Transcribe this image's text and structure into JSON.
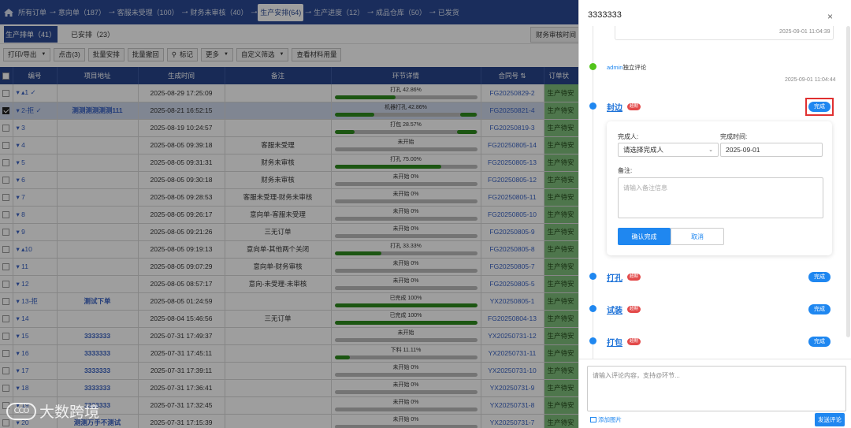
{
  "nav": {
    "items": [
      "所有订单",
      "意向单（187）",
      "客服未受理（100）",
      "财务未审核（40）",
      "生产安排(64)",
      "生产进度（12）",
      "成品仓库（50）",
      "已发货"
    ],
    "separator": "---•",
    "active_index": 4
  },
  "tabs": {
    "primary": "生产排单（41）",
    "secondary": "已安排（23）",
    "right": "财务审核时间"
  },
  "toolbar": {
    "buttons": [
      {
        "label": "打印/导出",
        "caret": "▼"
      },
      {
        "label": "点击(3)",
        "caret": ""
      },
      {
        "label": "批量安排",
        "caret": ""
      },
      {
        "label": "批量撤回",
        "caret": ""
      },
      {
        "label": "标记",
        "caret": ""
      },
      {
        "label": "更多",
        "caret": "▼"
      },
      {
        "label": "自定义筛选",
        "caret": "▼"
      },
      {
        "label": "查看材料用量",
        "caret": ""
      }
    ]
  },
  "table": {
    "headers": [
      "编号",
      "项目地址",
      "生成时间",
      "备注",
      "环节详情",
      "合同号 ⇅",
      "订单状"
    ],
    "rows": [
      {
        "check": false,
        "id": "▾ ▴1 ✓",
        "addr": "",
        "time": "2025-08-29 17:25:09",
        "note": "",
        "pt": "打孔 42.86%",
        "pv": [
          0.43
        ],
        "contract": "FG20250829-2",
        "status": "生产待安",
        "sel": false
      },
      {
        "check": true,
        "id": "▾ 2-拒 ✓",
        "addr": "测测测测测测111",
        "time": "2025-08-21 16:52:15",
        "note": "",
        "pt": "机器打孔 42.86%",
        "pv": [
          0.28,
          0.12
        ],
        "contract": "FG20250821-4",
        "status": "生产待安",
        "sel": true
      },
      {
        "check": false,
        "id": "▾ 3",
        "addr": "",
        "time": "2025-08-19 10:24:57",
        "note": "",
        "pt": "打包 28.57%",
        "pv": [
          0.14,
          0.14
        ],
        "contract": "FG20250819-3",
        "status": "生产待安",
        "sel": false
      },
      {
        "check": false,
        "id": "▾ 4",
        "addr": "",
        "time": "2025-08-05 09:39:18",
        "note": "客服未受理",
        "pt": "未开始",
        "pv": [
          0
        ],
        "contract": "FG20250805-14",
        "status": "生产待安",
        "sel": false
      },
      {
        "check": false,
        "id": "▾ 5",
        "addr": "",
        "time": "2025-08-05 09:31:31",
        "note": "财务未审核",
        "pt": "打孔 75.00%",
        "pv": [
          0.75
        ],
        "contract": "FG20250805-13",
        "status": "生产待安",
        "sel": false
      },
      {
        "check": false,
        "id": "▾ 6",
        "addr": "",
        "time": "2025-08-05 09:30:18",
        "note": "财务未审核",
        "pt": "未开始 0%",
        "pv": [
          0
        ],
        "contract": "FG20250805-12",
        "status": "生产待安",
        "sel": false
      },
      {
        "check": false,
        "id": "▾ 7",
        "addr": "",
        "time": "2025-08-05 09:28:53",
        "note": "客服未受理-财务未审核",
        "pt": "未开始 0%",
        "pv": [
          0
        ],
        "contract": "FG20250805-11",
        "status": "生产待安",
        "sel": false
      },
      {
        "check": false,
        "id": "▾ 8",
        "addr": "",
        "time": "2025-08-05 09:26:17",
        "note": "意向单-客服未受理",
        "pt": "未开始 0%",
        "pv": [
          0
        ],
        "contract": "FG20250805-10",
        "status": "生产待安",
        "sel": false
      },
      {
        "check": false,
        "id": "▾ 9",
        "addr": "",
        "time": "2025-08-05 09:21:26",
        "note": "三无订单",
        "pt": "未开始 0%",
        "pv": [
          0
        ],
        "contract": "FG20250805-9",
        "status": "生产待安",
        "sel": false
      },
      {
        "check": false,
        "id": "▾ ▴10",
        "addr": "",
        "time": "2025-08-05 09:19:13",
        "note": "意向单-其他两个关闭",
        "pt": "打孔 33.33%",
        "pv": [
          0.33
        ],
        "contract": "FG20250805-8",
        "status": "生产待安",
        "sel": false
      },
      {
        "check": false,
        "id": "▾ 11",
        "addr": "",
        "time": "2025-08-05 09:07:29",
        "note": "意向单-财务审核",
        "pt": "未开始 0%",
        "pv": [
          0
        ],
        "contract": "FG20250805-7",
        "status": "生产待安",
        "sel": false
      },
      {
        "check": false,
        "id": "▾ 12",
        "addr": "",
        "time": "2025-08-05 08:57:17",
        "note": "意向-未受理-未审核",
        "pt": "未开始 0%",
        "pv": [
          0
        ],
        "contract": "FG20250805-5",
        "status": "生产待安",
        "sel": false
      },
      {
        "check": false,
        "id": "▾ 13-拒",
        "addr": "测试下单",
        "time": "2025-08-05 01:24:59",
        "note": "",
        "pt": "已完成 100%",
        "pv": [
          1
        ],
        "contract": "YX20250805-1",
        "status": "生产待安",
        "sel": false
      },
      {
        "check": false,
        "id": "▾ 14",
        "addr": "",
        "time": "2025-08-04 15:46:56",
        "note": "三无订单",
        "pt": "已完成 100%",
        "pv": [
          1
        ],
        "contract": "FG20250804-13",
        "status": "生产待安",
        "sel": false
      },
      {
        "check": false,
        "id": "▾ 15",
        "addr": "3333333",
        "time": "2025-07-31 17:49:37",
        "note": "",
        "pt": "未开始",
        "pv": [
          0
        ],
        "contract": "YX20250731-12",
        "status": "生产待安",
        "sel": false
      },
      {
        "check": false,
        "id": "▾ 16",
        "addr": "3333333",
        "time": "2025-07-31 17:45:11",
        "note": "",
        "pt": "下料 11.11%",
        "pv": [
          0.11
        ],
        "contract": "YX20250731-11",
        "status": "生产待安",
        "sel": false
      },
      {
        "check": false,
        "id": "▾ 17",
        "addr": "3333333",
        "time": "2025-07-31 17:39:11",
        "note": "",
        "pt": "未开始 0%",
        "pv": [
          0
        ],
        "contract": "YX20250731-10",
        "status": "生产待安",
        "sel": false
      },
      {
        "check": false,
        "id": "▾ 18",
        "addr": "3333333",
        "time": "2025-07-31 17:36:41",
        "note": "",
        "pt": "未开始 0%",
        "pv": [
          0
        ],
        "contract": "YX20250731-9",
        "status": "生产待安",
        "sel": false
      },
      {
        "check": false,
        "id": "▾ 19",
        "addr": "3333333",
        "time": "2025-07-31 17:32:45",
        "note": "",
        "pt": "未开始 0%",
        "pv": [
          0
        ],
        "contract": "YX20250731-8",
        "status": "生产待安",
        "sel": false
      },
      {
        "check": false,
        "id": "▾ 20",
        "addr": "测测万手不测试",
        "time": "2025-07-31 17:15:39",
        "note": "",
        "pt": "未开始 0%",
        "pv": [
          0
        ],
        "contract": "YX20250731-7",
        "status": "生产待安",
        "sel": false
      }
    ]
  },
  "watermark": {
    "logo": "CCO",
    "text": "大数跨境"
  },
  "drawer": {
    "title": "3333333",
    "close": "×",
    "ts_top": "2025-09-01 11:04:39",
    "comment_user": "admin",
    "comment_text": "独立评论",
    "ts_comment": "2025-09-01 11:04:44",
    "nodes": [
      {
        "name": "封边",
        "badge": "超期",
        "done": "完成"
      },
      {
        "name": "打孔",
        "badge": "超期",
        "done": "完成"
      },
      {
        "name": "试装",
        "badge": "超期",
        "done": "完成"
      },
      {
        "name": "打包",
        "badge": "超期",
        "done": "完成"
      }
    ],
    "form": {
      "completer_label": "完成人:",
      "completer_placeholder": "请选择完成人",
      "time_label": "完成时间:",
      "time_value": "2025-09-01",
      "note_label": "备注:",
      "note_placeholder": "请输入备注信息",
      "confirm": "确认完成",
      "cancel": "取消"
    },
    "comment_placeholder": "请输入评论内容，支持@环节...",
    "add_image": "添加图片",
    "send": "发送评论"
  },
  "colors": {
    "nav": "#2a4a95",
    "accent": "#1f87f0",
    "progress": "#2e8b1e",
    "status": "#7fbf7b",
    "badge": "#e34a4a"
  }
}
